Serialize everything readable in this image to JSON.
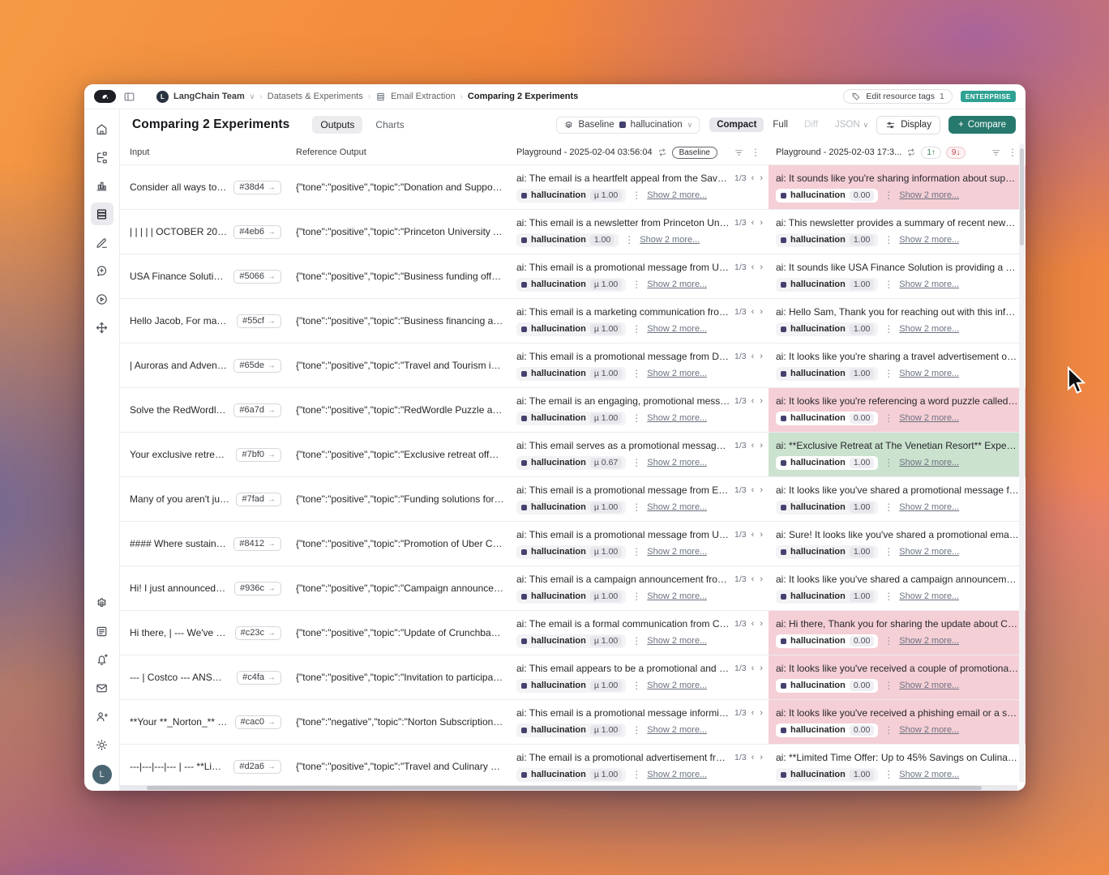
{
  "breadcrumb": {
    "team": "LangChain Team",
    "separator": "›",
    "items": [
      "Datasets & Experiments",
      "Email Extraction"
    ],
    "current": "Comparing 2 Experiments",
    "team_initial": "L"
  },
  "top_right": {
    "edit_tags_label": "Edit resource tags",
    "edit_tags_count": "1",
    "plan_badge": "ENTERPRISE"
  },
  "header": {
    "title": "Comparing 2 Experiments",
    "tabs": [
      {
        "label": "Outputs",
        "active": true
      },
      {
        "label": "Charts",
        "active": false
      }
    ],
    "controls": {
      "baseline_label": "Baseline",
      "metric": "hallucination",
      "chevron": "∨",
      "modes": [
        "Compact",
        "Full",
        "Diff"
      ],
      "active_mode": "Compact",
      "json_label": "JSON",
      "display_label": "Display",
      "compare_plus": "+",
      "compare_label": "Compare"
    }
  },
  "colors": {
    "accent_teal": "#27796d",
    "pink_highlight": "#f5cfd6",
    "green_highlight": "#cbe2cf",
    "metric_dot": "#44416e"
  },
  "sidebar": {
    "top": [
      {
        "name": "home",
        "icon": "home",
        "active": false
      },
      {
        "name": "tracing-projects",
        "icon": "flow",
        "active": false
      },
      {
        "name": "monitoring",
        "icon": "chart",
        "active": false
      },
      {
        "name": "datasets",
        "icon": "stack",
        "active": true
      },
      {
        "name": "annotation-queues",
        "icon": "pencil",
        "active": false
      },
      {
        "name": "prompts",
        "icon": "comment-plus",
        "active": false
      },
      {
        "name": "playground",
        "icon": "play-circle",
        "active": false
      },
      {
        "name": "deployments",
        "icon": "move",
        "active": false
      }
    ],
    "bottom": [
      {
        "name": "settings",
        "icon": "gear",
        "active": false
      },
      {
        "name": "changelog",
        "icon": "news",
        "active": false
      },
      {
        "name": "notifications",
        "icon": "bell-plus",
        "active": false
      },
      {
        "name": "feedback",
        "icon": "mail",
        "active": false
      },
      {
        "name": "invite-members",
        "icon": "user-plus",
        "active": false
      },
      {
        "name": "theme",
        "icon": "sun",
        "active": false
      }
    ],
    "avatar_letter": "L"
  },
  "table": {
    "labels": {
      "input": "Input",
      "reference": "Reference Output",
      "pagination": "1/3",
      "prev": "‹",
      "next": "›",
      "kebab": "⋮",
      "show_more": "Show 2 more...",
      "metric": "hallucination",
      "open_arrow": "→"
    },
    "exp1": {
      "title": "Playground - 2025-02-04 03:56:04",
      "badge": "Baseline"
    },
    "exp2": {
      "title": "Playground - 2025-02-03 17:3...",
      "up_count": "1",
      "up_arrow": "↑",
      "down_count": "9",
      "down_arrow": "↓"
    },
    "rows": [
      {
        "input": "Consider all ways to give to...",
        "example_id": "#38d4",
        "reference": "{\"tone\":\"positive\",\"topic\":\"Donation and Support for S...",
        "exp1_output": "ai: The email is a heartfelt appeal from the Save the Re...",
        "exp1_score": "µ 1.00",
        "exp2_output": "ai: It sounds like you're sharing information about supporting ...",
        "exp2_score": "0.00",
        "highlight": "pink"
      },
      {
        "input": "| | | | | OCTOBER 2023, VOL...",
        "example_id": "#4eb6",
        "reference": "{\"tone\":\"positive\",\"topic\":\"Princeton University Alumn...",
        "exp1_output": "ai: This email is a newsletter from Princeton University...",
        "exp1_score": "1.00",
        "exp2_output": "ai: This newsletter provides a summary of recent news and ev...",
        "exp2_score": "1.00",
        "highlight": ""
      },
      {
        "input": "USA Finance Solution offer...",
        "example_id": "#5066",
        "reference": "{\"tone\":\"positive\",\"topic\":\"Business funding offers\",\"s...",
        "exp1_output": "ai: This email is a promotional message from USA Fina...",
        "exp1_score": "µ 1.00",
        "exp2_output": "ai: It sounds like USA Finance Solution is providing a convenie...",
        "exp2_score": "1.00",
        "highlight": ""
      },
      {
        "input": "Hello Jacob, For many small...",
        "example_id": "#55cf",
        "reference": "{\"tone\":\"positive\",\"topic\":\"Business financing and loa...",
        "exp1_output": "ai: This email is a marketing communication from Sam...",
        "exp1_score": "µ 1.00",
        "exp2_output": "ai: Hello Sam, Thank you for reaching out with this information...",
        "exp2_score": "1.00",
        "highlight": ""
      },
      {
        "input": "| Auroras and Adventure A...",
        "example_id": "#65de",
        "reference": "{\"tone\":\"positive\",\"topic\":\"Travel and Tourism in Anch...",
        "exp1_output": "ai: This email is a promotional message from Dunhill V...",
        "exp1_score": "µ 1.00",
        "exp2_output": "ai: It looks like you're sharing a travel advertisement or newsle...",
        "exp2_score": "1.00",
        "highlight": ""
      },
      {
        "input": "Solve the RedWordle We kn...",
        "example_id": "#6a7d",
        "reference": "{\"tone\":\"positive\",\"topic\":\"RedWordle Puzzle and Red...",
        "exp1_output": "ai: The email is an engaging, promotional message fro...",
        "exp1_score": "µ 1.00",
        "exp2_output": "ai: It looks like you're referencing a word puzzle called \"RedW...",
        "exp2_score": "0.00",
        "highlight": "pink"
      },
      {
        "input": "Your exclusive retreat at Th...",
        "example_id": "#7bf0",
        "reference": "{\"tone\":\"positive\",\"topic\":\"Exclusive retreat offer at T...",
        "exp1_output": "ai: This email serves as a promotional message from T...",
        "exp1_score": "µ 0.67",
        "exp2_output": "ai: **Exclusive Retreat at The Venetian Resort** Experience lu...",
        "exp2_score": "1.00",
        "highlight": "green"
      },
      {
        "input": "Many of you aren't just runn...",
        "example_id": "#7fad",
        "reference": "{\"tone\":\"positive\",\"topic\":\"Funding solutions for busin...",
        "exp1_output": "ai: This email is a promotional message from EMC Fin...",
        "exp1_score": "µ 1.00",
        "exp2_output": "ai: It looks like you've shared a promotional message from EM...",
        "exp2_score": "1.00",
        "highlight": ""
      },
      {
        "input": "#### Where sustainability ...",
        "example_id": "#8412",
        "reference": "{\"tone\":\"positive\",\"topic\":\"Promotion of Uber Comfort...",
        "exp1_output": "ai: This email is a promotional message from Uber Tec...",
        "exp1_score": "µ 1.00",
        "exp2_output": "ai: Sure! It looks like you've shared a promotional email for Ub...",
        "exp2_score": "1.00",
        "highlight": ""
      },
      {
        "input": "Hi! I just announced that I w...",
        "example_id": "#936c",
        "reference": "{\"tone\":\"positive\",\"topic\":\"Campaign announcement a...",
        "exp1_output": "ai: This email is a campaign announcement from Sena...",
        "exp1_score": "µ 1.00",
        "exp2_output": "ai: It looks like you've shared a campaign announcement from ...",
        "exp2_score": "1.00",
        "highlight": ""
      },
      {
        "input": "Hi there, | --- We've update...",
        "example_id": "#c23c",
        "reference": "{\"tone\":\"positive\",\"topic\":\"Update of Crunchbase's go...",
        "exp1_output": "ai: The email is a formal communication from Crunchb...",
        "exp1_score": "µ 1.00",
        "exp2_output": "ai: Hi there, Thank you for sharing the update about Crunchba...",
        "exp2_score": "0.00",
        "highlight": "pink"
      },
      {
        "input": "--- | Costco --- ANSWER & ...",
        "example_id": "#c4fa",
        "reference": "{\"tone\":\"positive\",\"topic\":\"Invitation to participate in a...",
        "exp1_output": "ai: This email appears to be a promotional and informa...",
        "exp1_score": "µ 1.00",
        "exp2_output": "ai: It looks like you've received a couple of promotional messa...",
        "exp2_score": "0.00",
        "highlight": "pink"
      },
      {
        "input": "**Your **_Norton_** subsc...",
        "example_id": "#cac0",
        "reference": "{\"tone\":\"negative\",\"topic\":\"Norton Subscription Expir...",
        "exp1_output": "ai: This email is a promotional message informing the ...",
        "exp1_score": "µ 1.00",
        "exp2_output": "ai: It looks like you've received a phishing email or a spam me...",
        "exp2_score": "0.00",
        "highlight": "pink"
      },
      {
        "input": "---|---|---|--- | --- **Limite...",
        "example_id": "#d2a6",
        "reference": "{\"tone\":\"positive\",\"topic\":\"Travel and Culinary Tour Di...",
        "exp1_output": "ai: The email is a promotional advertisement from Dun...",
        "exp1_score": "µ 1.00",
        "exp2_output": "ai: **Limited Time Offer: Up to 45% Savings on Culinary Tour...",
        "exp2_score": "1.00",
        "highlight": ""
      }
    ]
  }
}
